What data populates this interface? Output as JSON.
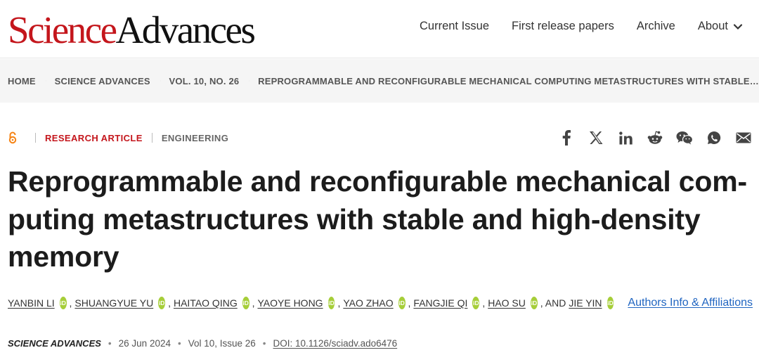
{
  "header": {
    "logo_part1": "Science",
    "logo_part2": "Advances",
    "nav": [
      "Current Issue",
      "First release papers",
      "Archive",
      "About"
    ]
  },
  "breadcrumb": {
    "items": [
      "HOME",
      "SCIENCE ADVANCES",
      "VOL. 10, NO. 26",
      "REPROGRAMMABLE AND RECONFIGURABLE MECHANICAL COMPUTING METASTRUCTURES WITH STABLE…"
    ]
  },
  "article": {
    "type": "RESEARCH ARTICLE",
    "subject": "ENGINEERING",
    "title_lines": [
      "Reprogrammable and reconfigurable mechanical com-",
      "puting metastructures with stable and high-density",
      "memory"
    ],
    "authors": [
      "YANBIN LI",
      "SHUANGYUE YU",
      "HAITAO QING",
      "YAOYE HONG",
      "YAO ZHAO",
      "FANGJIE QI",
      "HAO SU",
      "JIE YIN"
    ],
    "and_text": ", AND",
    "orcid_label": "iD",
    "affiliations_link": "Authors Info & Affiliations",
    "journal": "SCIENCE ADVANCES",
    "date": "26 Jun 2024",
    "volume": "Vol 10, Issue 26",
    "doi": "DOI: 10.1126/sciadv.ado6476"
  },
  "share_icons": [
    "facebook-icon",
    "x-icon",
    "linkedin-icon",
    "reddit-icon",
    "wechat-icon",
    "whatsapp-icon",
    "email-icon"
  ],
  "colors": {
    "brand_red": "#c4161c",
    "orcid_green": "#a6ce39",
    "link_blue": "#2065c1",
    "open_access_orange": "#f68212"
  }
}
